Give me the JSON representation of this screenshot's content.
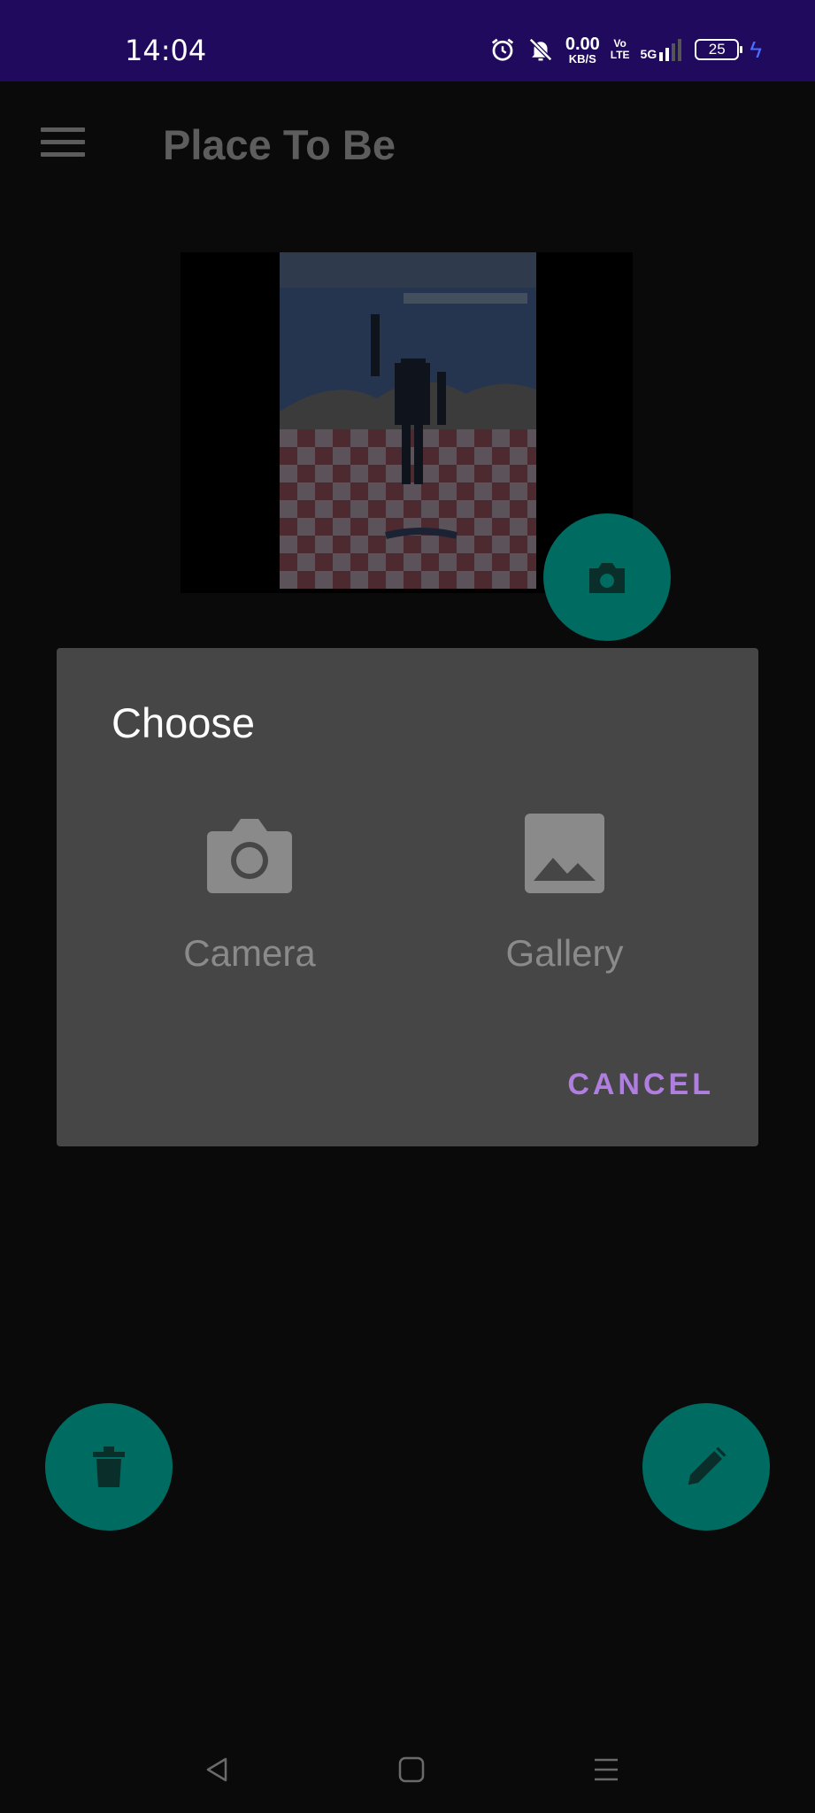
{
  "status_bar": {
    "time": "14:04",
    "net_speed_value": "0.00",
    "net_speed_unit": "KB/S",
    "volte_top": "Vo",
    "volte_bottom": "LTE",
    "network": "5G",
    "battery": "25",
    "icons": [
      "alarm-icon",
      "silent-icon",
      "signal-icon",
      "battery-icon",
      "charging-icon"
    ]
  },
  "app_bar": {
    "title": "Place To Be",
    "menu_icon": "hamburger-menu-icon"
  },
  "photo": {
    "description_icon": "robot-photo"
  },
  "fabs": {
    "camera_icon": "camera-icon",
    "delete_icon": "trash-icon",
    "edit_icon": "pencil-icon",
    "color": "#006b61"
  },
  "dialog": {
    "title": "Choose",
    "options": [
      {
        "label": "Camera",
        "icon": "camera-icon"
      },
      {
        "label": "Gallery",
        "icon": "image-icon"
      }
    ],
    "cancel_label": "CANCEL",
    "accent": "#b07ee0"
  },
  "nav_bar": {
    "icons": [
      "back-icon",
      "home-icon",
      "recents-icon"
    ]
  }
}
